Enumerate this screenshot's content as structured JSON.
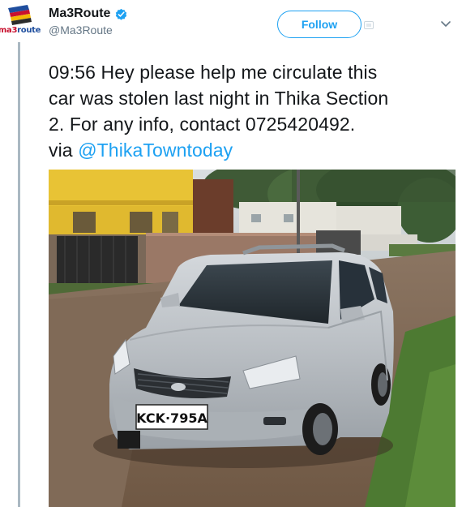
{
  "account": {
    "display_name": "Ma3Route",
    "handle": "@Ma3Route",
    "avatar_text_ma": "ma3",
    "avatar_text_route": "route",
    "verified": true
  },
  "actions": {
    "follow_label": "Follow"
  },
  "tweet": {
    "text_line1": "09:56 Hey please help me circulate this",
    "text_line2": "car was stolen last night in Thika Section",
    "text_line3": "2.  For any info, contact 0725420492.",
    "text_line4_prefix": "via ",
    "mention": "@ThikaTowntoday"
  },
  "photo": {
    "plate_text": "KCK·795A"
  },
  "colors": {
    "accent": "#1da1f2",
    "text": "#14171a",
    "secondary": "#657786",
    "rule": "#aab8c2"
  },
  "icons": {
    "verified": "verified-badge-icon",
    "menu": "chevron-down-icon",
    "media": "media-icon"
  }
}
